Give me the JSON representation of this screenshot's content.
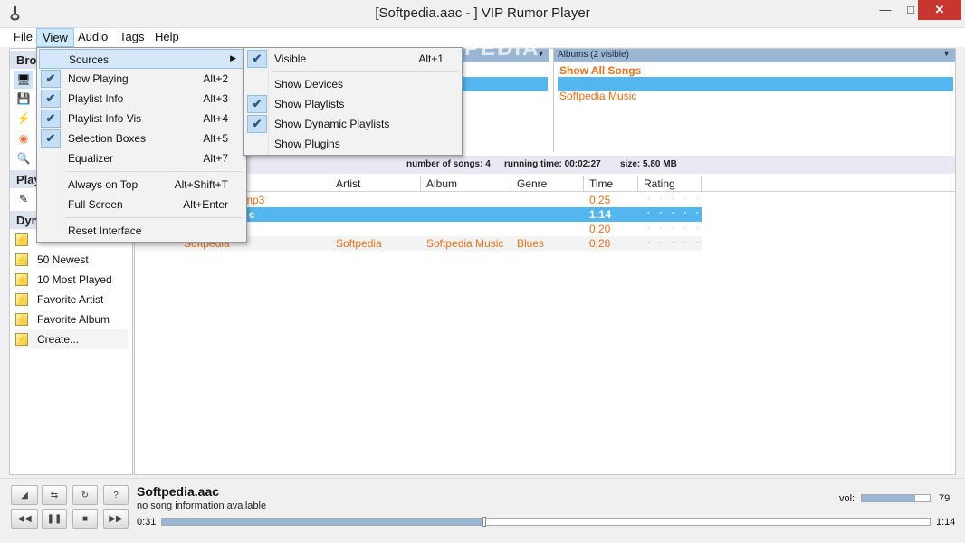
{
  "window": {
    "title": "[Softpedia.aac - ] VIP Rumor Player",
    "minimize": "—",
    "maximize": "□",
    "close": "✕"
  },
  "menubar": {
    "items": [
      "File",
      "View",
      "Audio",
      "Tags",
      "Help"
    ]
  },
  "sidebar": {
    "browse_head": "Bro",
    "playlists_head": "Play",
    "dynamic_head": "Dyn",
    "browse_icons": [
      "devices-icon",
      "save-icon",
      "lightning-icon",
      "podcast-icon",
      "search-icon"
    ],
    "dynamic_items": [
      "50 Newest",
      "10 Most Played",
      "Favorite Artist",
      "Favorite Album",
      "Create..."
    ]
  },
  "browser": {
    "albums_head": "Albums (2 visible)",
    "albums_items": [
      "Show All Songs",
      "",
      "Softpedia Music"
    ]
  },
  "stats": {
    "songs": "number of songs: 4",
    "time": "running time: 00:02:27",
    "size": "size: 5.80 MB"
  },
  "table": {
    "columns": [
      "Artist",
      "Album",
      "Genre",
      "Time",
      "Rating"
    ],
    "rows": [
      {
        "title": "mp3",
        "artist": "",
        "album": "",
        "genre": "",
        "time": "0:25",
        "rating": "· · · · ·"
      },
      {
        "title": "c",
        "artist": "",
        "album": "",
        "genre": "",
        "time": "1:14",
        "rating": "· · · · ·"
      },
      {
        "title": "",
        "artist": "",
        "album": "",
        "genre": "",
        "time": "0:20",
        "rating": "· · · · ·"
      },
      {
        "title": "Softpedia",
        "artist": "Softpedia",
        "album": "Softpedia Music",
        "genre": "Blues",
        "time": "0:28",
        "rating": "· · · · ·"
      }
    ]
  },
  "player": {
    "now_title": "Softpedia.aac",
    "now_info": "no song information available",
    "time_current": "0:31",
    "time_total": "1:14",
    "progress": 0.42,
    "volume_label": "vol:",
    "volume_value": "79",
    "volume": 0.79
  },
  "view_menu": {
    "items": [
      {
        "label": "Sources",
        "shortcut": "",
        "checked": false,
        "submenu": true
      },
      {
        "label": "Now Playing",
        "shortcut": "Alt+2",
        "checked": true
      },
      {
        "label": "Playlist Info",
        "shortcut": "Alt+3",
        "checked": true
      },
      {
        "label": "Playlist Info Vis",
        "shortcut": "Alt+4",
        "checked": true
      },
      {
        "label": "Selection Boxes",
        "shortcut": "Alt+5",
        "checked": true
      },
      {
        "label": "Equalizer",
        "shortcut": "Alt+7",
        "checked": false
      },
      {
        "label": "Always on Top",
        "shortcut": "Alt+Shift+T",
        "checked": false
      },
      {
        "label": "Full Screen",
        "shortcut": "Alt+Enter",
        "checked": false
      },
      {
        "label": "Reset Interface",
        "shortcut": "",
        "checked": false
      }
    ]
  },
  "sources_menu": {
    "items": [
      {
        "label": "Visible",
        "shortcut": "Alt+1",
        "checked": true
      },
      {
        "label": "Show Devices",
        "shortcut": "",
        "checked": false
      },
      {
        "label": "Show Playlists",
        "shortcut": "",
        "checked": true
      },
      {
        "label": "Show Dynamic Playlists",
        "shortcut": "",
        "checked": true
      },
      {
        "label": "Show Plugins",
        "shortcut": "",
        "checked": false
      }
    ]
  },
  "watermark": "SOFTPEDIA"
}
